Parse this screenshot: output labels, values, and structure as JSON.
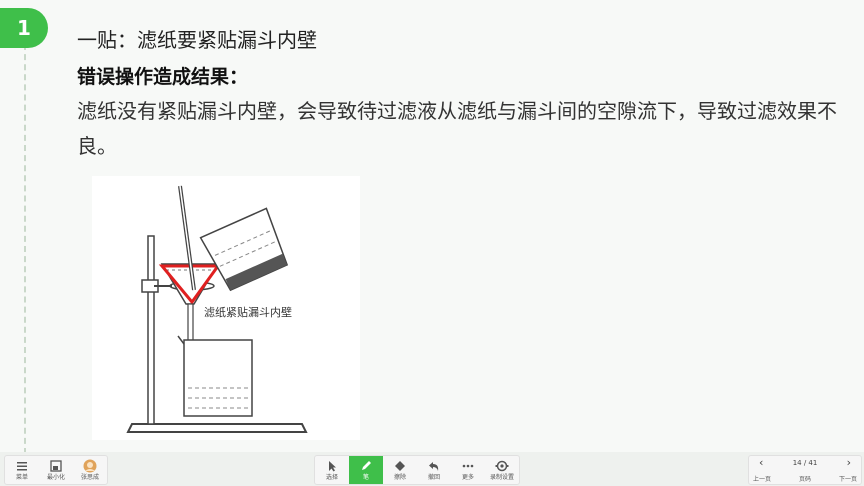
{
  "step": {
    "number": "1"
  },
  "content": {
    "line1": "一贴：滤纸要紧贴漏斗内壁",
    "line2": "错误操作造成结果：",
    "paragraph": "滤纸没有紧贴漏斗内壁，会导致待过滤液从滤纸与漏斗间的空隙流下，导致过滤效果不良。"
  },
  "figure": {
    "caption": "滤纸紧贴漏斗内壁"
  },
  "toolbar": {
    "left": [
      {
        "icon": "menu-icon",
        "label": "菜单"
      },
      {
        "icon": "minimize-icon",
        "label": "最小化"
      },
      {
        "icon": "avatar-icon",
        "label": "张思成"
      }
    ],
    "center": [
      {
        "icon": "select-icon",
        "label": "选择"
      },
      {
        "icon": "pen-icon",
        "label": "笔"
      },
      {
        "icon": "eraser-icon",
        "label": "擦除"
      },
      {
        "icon": "undo-icon",
        "label": "撤回"
      },
      {
        "icon": "more-icon",
        "label": "更多"
      },
      {
        "icon": "settings-icon",
        "label": "录制设置"
      }
    ],
    "pager": {
      "prev": "上一页",
      "page": "14 / 41",
      "pages_label": "页码",
      "next": "下一页"
    }
  },
  "colors": {
    "accent": "#3fbf4a",
    "funnel_highlight": "#e02020"
  }
}
